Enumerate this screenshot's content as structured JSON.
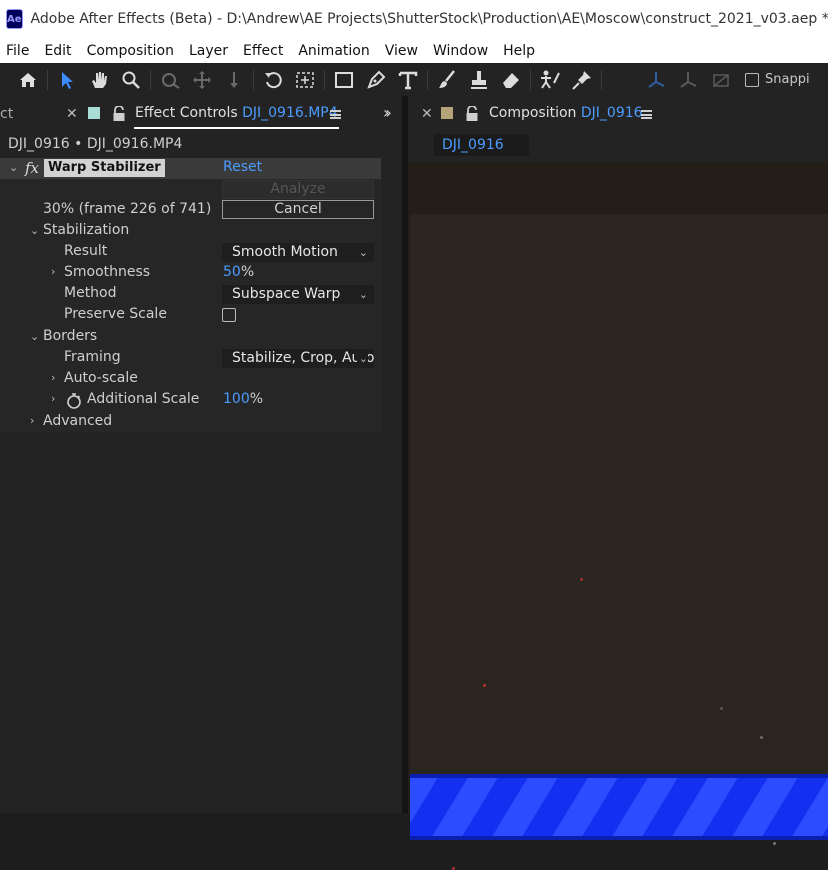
{
  "window": {
    "app_icon": "Ae",
    "title": "Adobe After Effects (Beta) - D:\\Andrew\\AE Projects\\ShutterStock\\Production\\AE\\Moscow\\construct_2021_v03.aep *"
  },
  "menu": [
    "File",
    "Edit",
    "Composition",
    "Layer",
    "Effect",
    "Animation",
    "View",
    "Window",
    "Help"
  ],
  "toolbar": {
    "icons": [
      "home-icon",
      "selection-tool-icon",
      "hand-tool-icon",
      "zoom-tool-icon",
      "orbit-camera-icon",
      "pan-camera-icon",
      "dolly-camera-icon",
      "rotation-tool-icon",
      "pan-behind-icon",
      "rectangle-tool-icon",
      "pen-tool-icon",
      "type-tool-icon",
      "brush-tool-icon",
      "clone-stamp-icon",
      "eraser-tool-icon",
      "roto-brush-icon",
      "puppet-pin-icon"
    ],
    "snapping_label": "Snappi"
  },
  "effect_panel": {
    "prev_tab_fragment": "ct",
    "tab_prefix": "Effect Controls",
    "tab_layer": "DJI_0916.MP4",
    "breadcrumb": "DJI_0916 • DJI_0916.MP4",
    "effect": {
      "fx": "fx",
      "name": "Warp Stabilizer",
      "reset": "Reset",
      "analyze_label": "Analyze",
      "progress_text": "30% (frame 226 of 741)",
      "cancel_label": "Cancel"
    },
    "stabilization": {
      "label": "Stabilization",
      "result_label": "Result",
      "result_value": "Smooth Motion",
      "smoothness_label": "Smoothness",
      "smoothness_value": "50",
      "smoothness_unit": "%",
      "method_label": "Method",
      "method_value": "Subspace Warp",
      "preserve_label": "Preserve Scale",
      "preserve_checked": false
    },
    "borders": {
      "label": "Borders",
      "framing_label": "Framing",
      "framing_value": "Stabilize, Crop, Auto",
      "autoscale_label": "Auto-scale",
      "additional_label": "Additional Scale",
      "additional_value": "100",
      "additional_unit": "%"
    },
    "advanced_label": "Advanced"
  },
  "composition_panel": {
    "tab_prefix": "Composition",
    "tab_name": "DJI_0916",
    "subtab": "DJI_0916"
  },
  "colors": {
    "accent_blue": "#4c9cff",
    "panel_bg": "#232323",
    "stripe_blue": "#1330f0"
  }
}
